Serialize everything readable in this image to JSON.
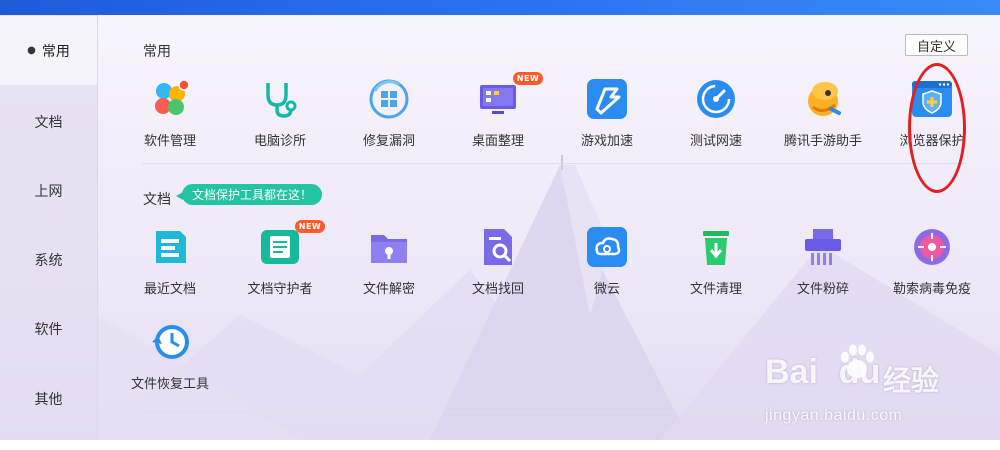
{
  "sidebar": {
    "items": [
      {
        "label": "常用",
        "active": true
      },
      {
        "label": "文档"
      },
      {
        "label": "上网"
      },
      {
        "label": "系统"
      },
      {
        "label": "软件"
      },
      {
        "label": "其他"
      }
    ]
  },
  "common": {
    "title": "常用",
    "customize_label": "自定义",
    "tools": [
      {
        "label": "软件管理",
        "icon": "software-manager-icon"
      },
      {
        "label": "电脑诊所",
        "icon": "stethoscope-icon"
      },
      {
        "label": "修复漏洞",
        "icon": "windows-repair-icon"
      },
      {
        "label": "桌面整理",
        "icon": "desktop-organize-icon",
        "badge": "NEW"
      },
      {
        "label": "游戏加速",
        "icon": "game-boost-icon"
      },
      {
        "label": "测试网速",
        "icon": "speedometer-icon"
      },
      {
        "label": "腾讯手游助手",
        "icon": "mobile-game-assistant-icon"
      },
      {
        "label": "浏览器保护",
        "icon": "browser-shield-icon"
      }
    ]
  },
  "docs": {
    "title": "文档",
    "tip": "文档保护工具都在这！",
    "tools": [
      {
        "label": "最近文档",
        "icon": "recent-docs-icon"
      },
      {
        "label": "文档守护者",
        "icon": "doc-guardian-icon",
        "badge": "NEW"
      },
      {
        "label": "文件解密",
        "icon": "folder-lock-icon"
      },
      {
        "label": "文档找回",
        "icon": "doc-search-icon"
      },
      {
        "label": "微云",
        "icon": "cloud-icon"
      },
      {
        "label": "文件清理",
        "icon": "trash-icon"
      },
      {
        "label": "文件粉碎",
        "icon": "shredder-icon"
      },
      {
        "label": "勒索病毒免疫",
        "icon": "virus-immune-icon"
      },
      {
        "label": "文件恢复工具",
        "icon": "file-restore-icon"
      }
    ]
  },
  "watermark": {
    "logo": "Bai",
    "logo2": "du",
    "cn": "经验",
    "url": "jingyan.baidu.com"
  },
  "colors": {
    "accent": "#2b74f0",
    "badge_new": "#ff5a2a",
    "tip": "#23c4a3",
    "highlight": "#e32020"
  }
}
